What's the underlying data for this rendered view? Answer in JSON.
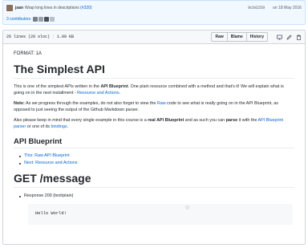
{
  "commit": {
    "author": "jsan",
    "message": "Wrap long lines in descriptions",
    "pr_link": "(#320)",
    "sha": "9cb6259",
    "date": "on 18 May 2016",
    "contributors": "3 contributors"
  },
  "file": {
    "lines": "26 lines (20 sloc)",
    "size": "1.09 KB",
    "buttons": {
      "raw": "Raw",
      "blame": "Blame",
      "history": "History"
    }
  },
  "content": {
    "format": "FORMAT: 1A",
    "title": "The Simplest API",
    "p1": {
      "t1": "This is one of the simplest APIs written in the ",
      "b1": "API Blueprint",
      "t2": ". One plain resource combined with a method and that's it! We will explain what is going on in the next installment - ",
      "link": "Resource and Actions",
      "t3": "."
    },
    "p2": {
      "b1": "Note:",
      "t1": " As we progress through the examples, do not also forget to view the ",
      "link": "Raw",
      "t2": " code to see what is really going on in the API Blueprint, as opposed to just seeing the output of the Github Markdown parser."
    },
    "p3": {
      "t1": "Also please keep in mind that every single example in this course is a ",
      "b1": "real API Blueprint",
      "t2": " and as such you can ",
      "b2": "parse",
      "t3": " it with the ",
      "link1": "API Blueprint parser",
      "t4": " or one of its ",
      "link2": "bindings",
      "t5": "."
    },
    "h2": "API Blueprint",
    "list": [
      "This: Raw API Blueprint",
      "Next: Resource and Actions"
    ],
    "h1b": "GET /message",
    "response": "Response 200 (text/plain)",
    "code": "Hello World!"
  }
}
